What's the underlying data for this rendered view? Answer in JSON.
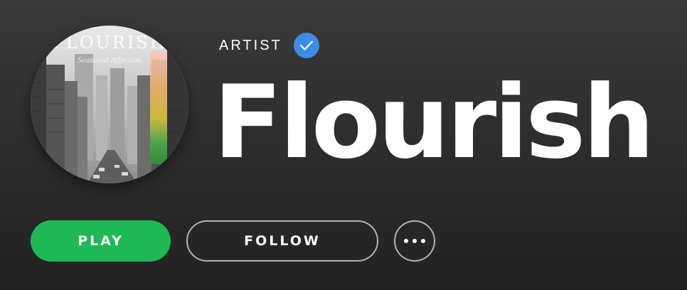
{
  "artist": {
    "type_label": "ARTIST",
    "name": "Flourish",
    "verified": true
  },
  "artwork": {
    "title": "FLOURISH",
    "subtitle": "Seasonal Affection"
  },
  "actions": {
    "play_label": "PLAY",
    "follow_label": "FOLLOW",
    "more_icon": "more-horizontal-icon"
  },
  "colors": {
    "play_green": "#1db954",
    "verified_blue": "#3d8be8",
    "background": "#2e2e2e",
    "outline": "#b3b3b3"
  }
}
